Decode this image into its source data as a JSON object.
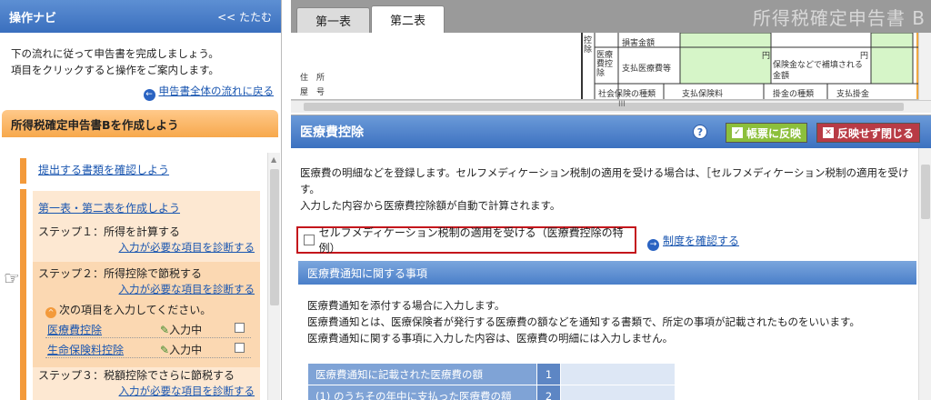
{
  "nav": {
    "title": "操作ナビ",
    "collapse": "<< たたむ",
    "intro_line1": "下の流れに従って申告書を完成しましょう。",
    "intro_line2": "項目をクリックすると操作をご案内します。",
    "flow_link": "申告書全体の流れに戻る",
    "section_title": "所得税確定申告書Bを作成しよう",
    "item_docs": "提出する書類を確認しよう",
    "item_forms": "第一表・第二表を作成しよう",
    "step1": "ステップ１：所得を計算する",
    "step1_link": "入力が必要な項目を診断する",
    "step2": "ステップ２：所得控除で節税する",
    "step2_link": "入力が必要な項目を診断する",
    "next_items": "次の項目を入力してください。",
    "sub_items": [
      {
        "label": "医療費控除",
        "status": "入力中"
      },
      {
        "label": "生命保険料控除",
        "status": "入力中"
      }
    ],
    "step3": "ステップ３：税額控除でさらに節税する",
    "step3_link": "入力が必要な項目を診断する"
  },
  "tabs": {
    "tab1": "第一表",
    "tab2": "第二表",
    "form_title": "所得税確定申告書 B"
  },
  "form": {
    "address": "住　所",
    "yago": "屋　号",
    "kojo": "控除",
    "iryo_kojo": "医療費控除",
    "son": "損害金額",
    "shiharai": "支払医療費等",
    "en": "円",
    "hoken": "保険金などで補填される金額",
    "shakai": "社会保険の種類",
    "shiharai_hoken": "支払保険料",
    "kakekin": "掛金の種類",
    "shiharai_kake": "支払掛金",
    "grip": "III"
  },
  "dialog": {
    "title": "医療費控除",
    "help": "?",
    "apply": "帳票に反映",
    "cancel": "反映せず閉じる",
    "desc_line1": "医療費の明細などを登録します。セルフメディケーション税制の適用を受ける場合は、［セルフメディケーション税制の適用を受け",
    "desc_line2": "す。",
    "desc_line3": "入力した内容から医療費控除額が自動で計算されます。",
    "self_med_label": "セルフメディケーション税制の適用を受ける（医療費控除の特例）",
    "check_link": "制度を確認する",
    "section_title": "医療費通知に関する事項",
    "section_line1": "医療費通知を添付する場合に入力します。",
    "section_line2": "医療費通知とは、医療保険者が発行する医療費の額などを通知する書類で、所定の事項が記載されたものをいいます。",
    "section_line3": "医療費通知に関する事項に入力した内容は、医療費の明細には入力しません。",
    "table_rows": [
      {
        "label": "医療費通知に記載された医療費の額",
        "num": "1"
      },
      {
        "label": "(1) のうちその年中に支払った医療費の額",
        "num": "2"
      }
    ]
  }
}
